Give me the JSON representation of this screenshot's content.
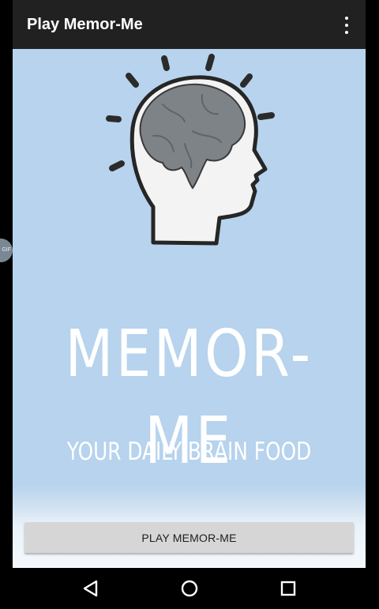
{
  "appbar": {
    "title": "Play Memor-Me",
    "overflow_icon": "more-vert-icon"
  },
  "content": {
    "logo_icon": "brain-head-icon",
    "brand_title": "MEMOR-ME",
    "tagline": "YOUR DAILY BRAIN FOOD",
    "side_tab_label": "GIF",
    "play_button_label": "PLAY MEMOR-ME",
    "background_color": "#b7d3ed"
  },
  "navbar": {
    "back_icon": "back-triangle-icon",
    "home_icon": "home-circle-icon",
    "recents_icon": "recents-square-icon"
  }
}
